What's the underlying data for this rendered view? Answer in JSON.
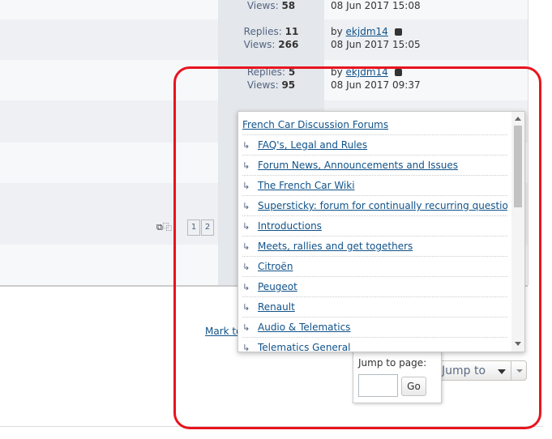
{
  "rows": [
    {
      "replies_label": "",
      "replies": "",
      "views_label": "Views:",
      "views": "58",
      "by": "",
      "author": "",
      "date": "08 Jun 2017 15:08"
    },
    {
      "replies_label": "Replies:",
      "replies": "11",
      "views_label": "Views:",
      "views": "266",
      "by": "by",
      "author": "ekjdm14",
      "date": "08 Jun 2017 15:05"
    },
    {
      "replies_label": "Replies:",
      "replies": "5",
      "views_label": "Views:",
      "views": "95",
      "by": "by",
      "author": "ekjdm14",
      "date": "08 Jun 2017 09:37"
    }
  ],
  "pagination": {
    "page1": "1",
    "page2": "2"
  },
  "mark_link": "Mark to",
  "jump": {
    "label": "Jump to"
  },
  "jump_page": {
    "title": "Jump to page:",
    "go": "Go"
  },
  "forums": [
    {
      "indent": "",
      "label": "French Car Discussion Forums"
    },
    {
      "indent": "↳",
      "label": "FAQ's, Legal and Rules"
    },
    {
      "indent": "↳",
      "label": "Forum News, Announcements and Issues"
    },
    {
      "indent": "↳",
      "label": "The French Car Wiki"
    },
    {
      "indent": "↳",
      "label": "Supersticky: forum for continually recurring questions."
    },
    {
      "indent": "↳",
      "label": "Introductions"
    },
    {
      "indent": "↳",
      "label": "Meets, rallies and get togethers"
    },
    {
      "indent": "↳",
      "label": "Citroën"
    },
    {
      "indent": "↳",
      "label": "Peugeot"
    },
    {
      "indent": "↳",
      "label": "Renault"
    },
    {
      "indent": "↳",
      "label": "Audio & Telematics"
    },
    {
      "indent": "↳",
      "label": "Telematics General"
    }
  ]
}
